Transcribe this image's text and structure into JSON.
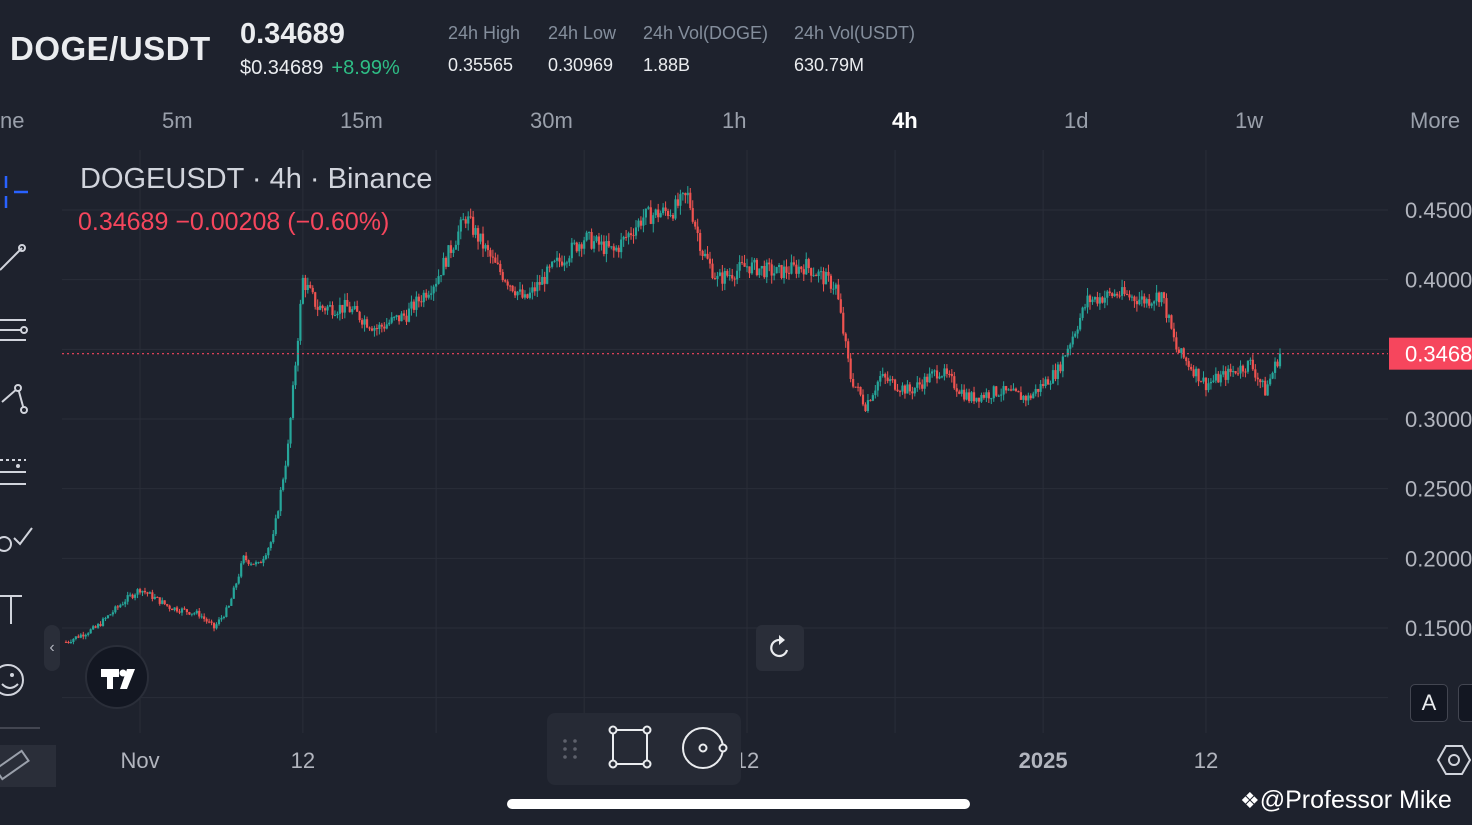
{
  "header": {
    "pair": "DOGE/USDT",
    "last_price": "0.34689",
    "last_price_usd": "$0.34689",
    "change_pct": "+8.99%",
    "stats": [
      {
        "label": "24h High",
        "value": "0.35565"
      },
      {
        "label": "24h Low",
        "value": "0.30969"
      },
      {
        "label": "24h Vol(DOGE)",
        "value": "1.88B"
      },
      {
        "label": "24h Vol(USDT)",
        "value": "630.79M"
      }
    ]
  },
  "timeframes": {
    "partial_first": "ne",
    "items": [
      "5m",
      "15m",
      "30m",
      "1h",
      "4h",
      "1d",
      "1w"
    ],
    "active": "4h",
    "more": "More"
  },
  "legend": {
    "title": "DOGEUSDT · 4h · Binance",
    "values": "0.34689  −0.00208 (−0.60%)"
  },
  "watermark": "@Professor Mike",
  "scale_button": "A",
  "colors": {
    "background": "#1e222d",
    "up": "#26a69a",
    "down": "#ef5350",
    "price_line": "#f6465d",
    "change_up": "#2ebd85"
  },
  "chart_data": {
    "type": "candlestick",
    "title": "DOGEUSDT · 4h · Binance",
    "current_price": 0.34689,
    "current_price_label": "0.3468",
    "ylim": [
      0.12,
      0.49
    ],
    "y_ticks": [
      {
        "value": 0.45,
        "label": "0.4500"
      },
      {
        "value": 0.4,
        "label": "0.4000"
      },
      {
        "value": 0.3,
        "label": "0.3000"
      },
      {
        "value": 0.25,
        "label": "0.2500"
      },
      {
        "value": 0.2,
        "label": "0.2000"
      },
      {
        "value": 0.15,
        "label": "0.1500"
      }
    ],
    "x_ticks": [
      {
        "label": "Nov",
        "bold": false
      },
      {
        "label": "12",
        "bold": false
      },
      {
        "label": "12",
        "bold": false
      },
      {
        "label": "2025",
        "bold": true
      },
      {
        "label": "12",
        "bold": false
      }
    ],
    "price_path": [
      [
        "2024-10-27",
        0.14
      ],
      [
        "2024-10-29",
        0.15
      ],
      [
        "2024-10-31",
        0.17
      ],
      [
        "2024-11-01",
        0.178
      ],
      [
        "2024-11-03",
        0.165
      ],
      [
        "2024-11-05",
        0.16
      ],
      [
        "2024-11-06",
        0.15
      ],
      [
        "2024-11-07",
        0.165
      ],
      [
        "2024-11-08",
        0.2
      ],
      [
        "2024-11-09",
        0.195
      ],
      [
        "2024-11-10",
        0.215
      ],
      [
        "2024-11-11",
        0.28
      ],
      [
        "2024-11-12",
        0.4
      ],
      [
        "2024-11-13",
        0.38
      ],
      [
        "2024-11-15",
        0.38
      ],
      [
        "2024-11-17",
        0.365
      ],
      [
        "2024-11-19",
        0.375
      ],
      [
        "2024-11-21",
        0.4
      ],
      [
        "2024-11-23",
        0.445
      ],
      [
        "2024-11-25",
        0.41
      ],
      [
        "2024-11-27",
        0.385
      ],
      [
        "2024-11-29",
        0.41
      ],
      [
        "2024-12-01",
        0.43
      ],
      [
        "2024-12-03",
        0.42
      ],
      [
        "2024-12-05",
        0.445
      ],
      [
        "2024-12-07",
        0.45
      ],
      [
        "2024-12-08",
        0.46
      ],
      [
        "2024-12-09",
        0.42
      ],
      [
        "2024-12-10",
        0.4
      ],
      [
        "2024-12-12",
        0.41
      ],
      [
        "2024-12-14",
        0.405
      ],
      [
        "2024-12-16",
        0.41
      ],
      [
        "2024-12-18",
        0.395
      ],
      [
        "2024-12-19",
        0.33
      ],
      [
        "2024-12-20",
        0.31
      ],
      [
        "2024-12-21",
        0.33
      ],
      [
        "2024-12-23",
        0.32
      ],
      [
        "2024-12-25",
        0.335
      ],
      [
        "2024-12-27",
        0.315
      ],
      [
        "2024-12-29",
        0.32
      ],
      [
        "2024-12-31",
        0.315
      ],
      [
        "2025-01-02",
        0.335
      ],
      [
        "2025-01-04",
        0.385
      ],
      [
        "2025-01-06",
        0.39
      ],
      [
        "2025-01-08",
        0.385
      ],
      [
        "2025-01-09",
        0.39
      ],
      [
        "2025-01-10",
        0.35
      ],
      [
        "2025-01-12",
        0.325
      ],
      [
        "2025-01-14",
        0.335
      ],
      [
        "2025-01-15",
        0.34
      ],
      [
        "2025-01-16",
        0.32
      ],
      [
        "2025-01-17",
        0.347
      ]
    ]
  }
}
